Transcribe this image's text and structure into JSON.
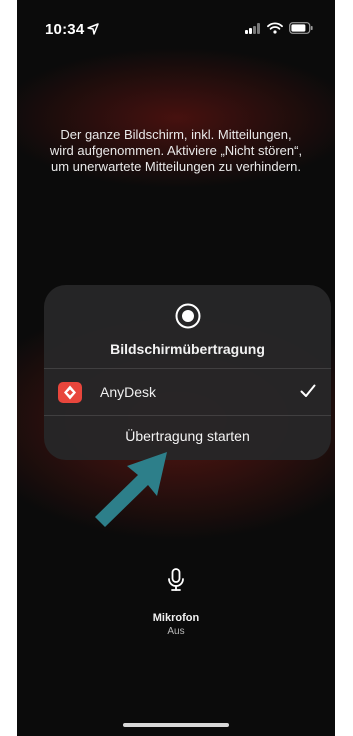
{
  "status_bar": {
    "time": "10:34"
  },
  "info": {
    "text": "Der ganze Bildschirm, inkl. Mitteilungen, wird aufgenommen. Aktiviere „Nicht stören“, um unerwartete Mitteilungen zu verhindern."
  },
  "broadcast_sheet": {
    "title": "Bildschirmübertragung",
    "app": {
      "name": "AnyDesk",
      "selected": true,
      "icon_color": "#e8463c"
    },
    "start_label": "Übertragung starten"
  },
  "microphone": {
    "label": "Mikrofon",
    "state": "Aus"
  },
  "annotation": {
    "arrow_color": "#2d7f8a"
  },
  "icons": {
    "status": [
      "location-arrow-icon",
      "signal-icon",
      "wifi-icon",
      "battery-icon"
    ],
    "sheet": [
      "record-icon",
      "anydesk-icon",
      "checkmark-icon"
    ],
    "microphone": "microphone-icon"
  }
}
